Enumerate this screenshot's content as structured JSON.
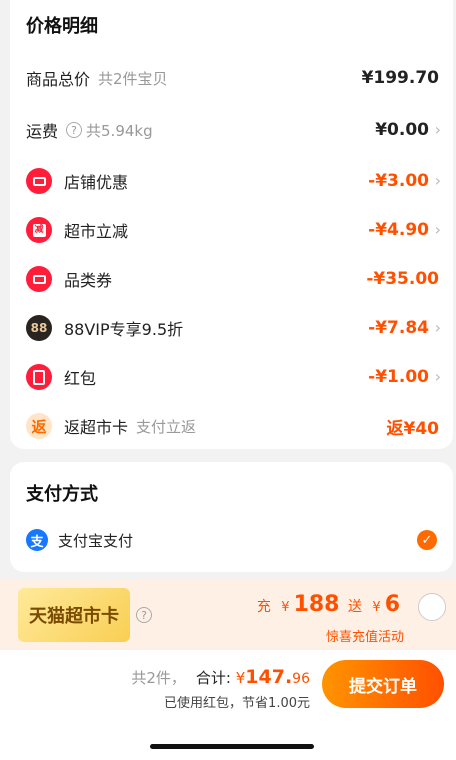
{
  "price_section": {
    "title": "价格明细",
    "total": {
      "label": "商品总价",
      "sub": "共2件宝贝",
      "amount": "¥199.70"
    },
    "shipping": {
      "label": "运费",
      "sub": "共5.94kg",
      "amount": "¥0.00"
    },
    "discounts": [
      {
        "label": "店铺优惠",
        "amount": "-¥3.00",
        "icon": "ticket-icon"
      },
      {
        "label": "超市立减",
        "amount": "-¥4.90",
        "icon": "supermarket-discount-icon"
      },
      {
        "label": "品类券",
        "amount": "-¥35.00",
        "icon": "category-coupon-icon"
      },
      {
        "label": "88VIP专享9.5折",
        "amount": "-¥7.84",
        "icon": "vip88-icon",
        "icon_text": "88"
      },
      {
        "label": "红包",
        "amount": "-¥1.00",
        "icon": "red-envelope-icon"
      }
    ],
    "cashback": {
      "label": "返超市卡",
      "sub": "支付立返",
      "amount": "返¥40",
      "icon_text": "返"
    }
  },
  "payment": {
    "title": "支付方式",
    "method": "支付宝支付",
    "icon_text": "支"
  },
  "promo": {
    "card_label": "天猫超市卡",
    "charge_label": "充",
    "charge_currency": "¥",
    "charge_amount": "188",
    "bonus_label": "送",
    "bonus_currency": "¥",
    "bonus_amount": "6",
    "subtitle": "惊喜充值活动"
  },
  "footer": {
    "count": "共2件，",
    "total_label": "合计:",
    "currency": "¥",
    "total_int": "147.",
    "total_dec": "96",
    "note": "已使用红包，节省1.00元",
    "submit": "提交订单"
  },
  "colors": {
    "accent": "#ff5000",
    "alipay": "#1677ff",
    "red_icon": "#ff1d3a"
  }
}
